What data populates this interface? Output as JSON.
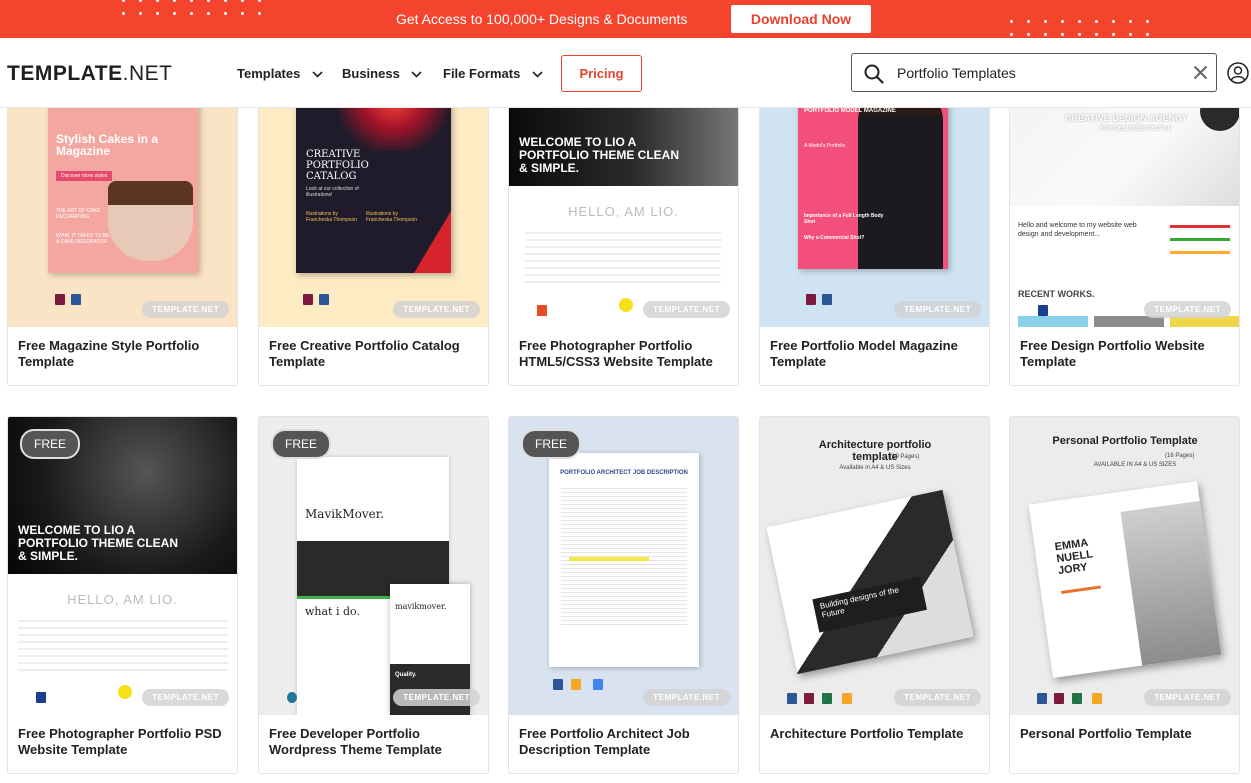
{
  "promo": {
    "text": "Get Access to 100,000+ Designs & Documents",
    "button": "Download Now"
  },
  "header": {
    "logo_main": "TEMPLATE",
    "logo_suffix": ".NET",
    "nav": [
      {
        "label": "Templates"
      },
      {
        "label": "Business"
      },
      {
        "label": "File Formats"
      }
    ],
    "pricing": "Pricing",
    "search_value": "Portfolio Templates"
  },
  "free_badge": "FREE",
  "watermark": "TEMPLATE.NET",
  "cards": [
    {
      "title": "Free Magazine Style Portfolio Template",
      "thumb": {
        "heading": "Stylish Cakes in a Magazine",
        "sub": "Discover more styles",
        "l1": "THE ART OF CAKE DECORATING",
        "l2": "WHAT IT TAKES TO BE A CAKE DECORATOR"
      }
    },
    {
      "title": "Free Creative Portfolio Catalog Template",
      "thumb": {
        "heading": "CREATIVE PORTFOLIO CATALOG",
        "sub": "Look at our collection of illustrations!",
        "l1": "Illustrations by Francheska Thompson",
        "l2": "Illustrations by Francheska Thompson"
      }
    },
    {
      "title": "Free Photographer Portfolio HTML5/CSS3 Website Template",
      "thumb": {
        "heading": "WELCOME TO LIO A PORTFOLIO THEME CLEAN & SIMPLE.",
        "sub": "HELLO, AM LIO."
      }
    },
    {
      "title": "Free Portfolio Model Magazine Template",
      "thumb": {
        "heading": "PORTFOLIO MODEL MAGAZINE",
        "sub": "A Model's Portfolio",
        "l1": "Importance of a Full Length Body Shot",
        "l2": "Why a Commercial Shot?"
      }
    },
    {
      "title": "Free Design Portfolio Website Template",
      "thumb": {
        "heading": "CREATIVE DESIGN AGENCY",
        "sub": "FOR DESIGNER PEOPLE",
        "l1": "Hello and welcome to my website web design and development...",
        "l2": "RECENT WORKS."
      }
    },
    {
      "title": "Free Photographer Portfolio PSD Website Template",
      "thumb": {
        "heading": "WELCOME TO LIO A PORTFOLIO THEME CLEAN & SIMPLE.",
        "sub": "HELLO, AM LIO."
      }
    },
    {
      "title": "Free Developer Portfolio Wordpress Theme Template",
      "thumb": {
        "heading": "MavikMover.",
        "sub": "what i do.",
        "l1": "mavikmover.",
        "l2": "Quality."
      }
    },
    {
      "title": "Free Portfolio Architect Job Description Template",
      "thumb": {
        "heading": "PORTFOLIO ARCHITECT JOB DESCRIPTION"
      }
    },
    {
      "title": "Architecture Portfolio Template",
      "thumb": {
        "heading": "Architecture portfolio template",
        "sub": "(10 Pages)",
        "l1": "Available in A4 & US Sizes",
        "l2": "Building designs of the Future"
      }
    },
    {
      "title": "Personal Portfolio Template",
      "thumb": {
        "heading": "Personal Portfolio Template",
        "sub": "(16 Pages)",
        "l1": "AVAILABLE IN A4 & US SIZES",
        "l2": "EMMA NUELL JORY"
      }
    }
  ]
}
